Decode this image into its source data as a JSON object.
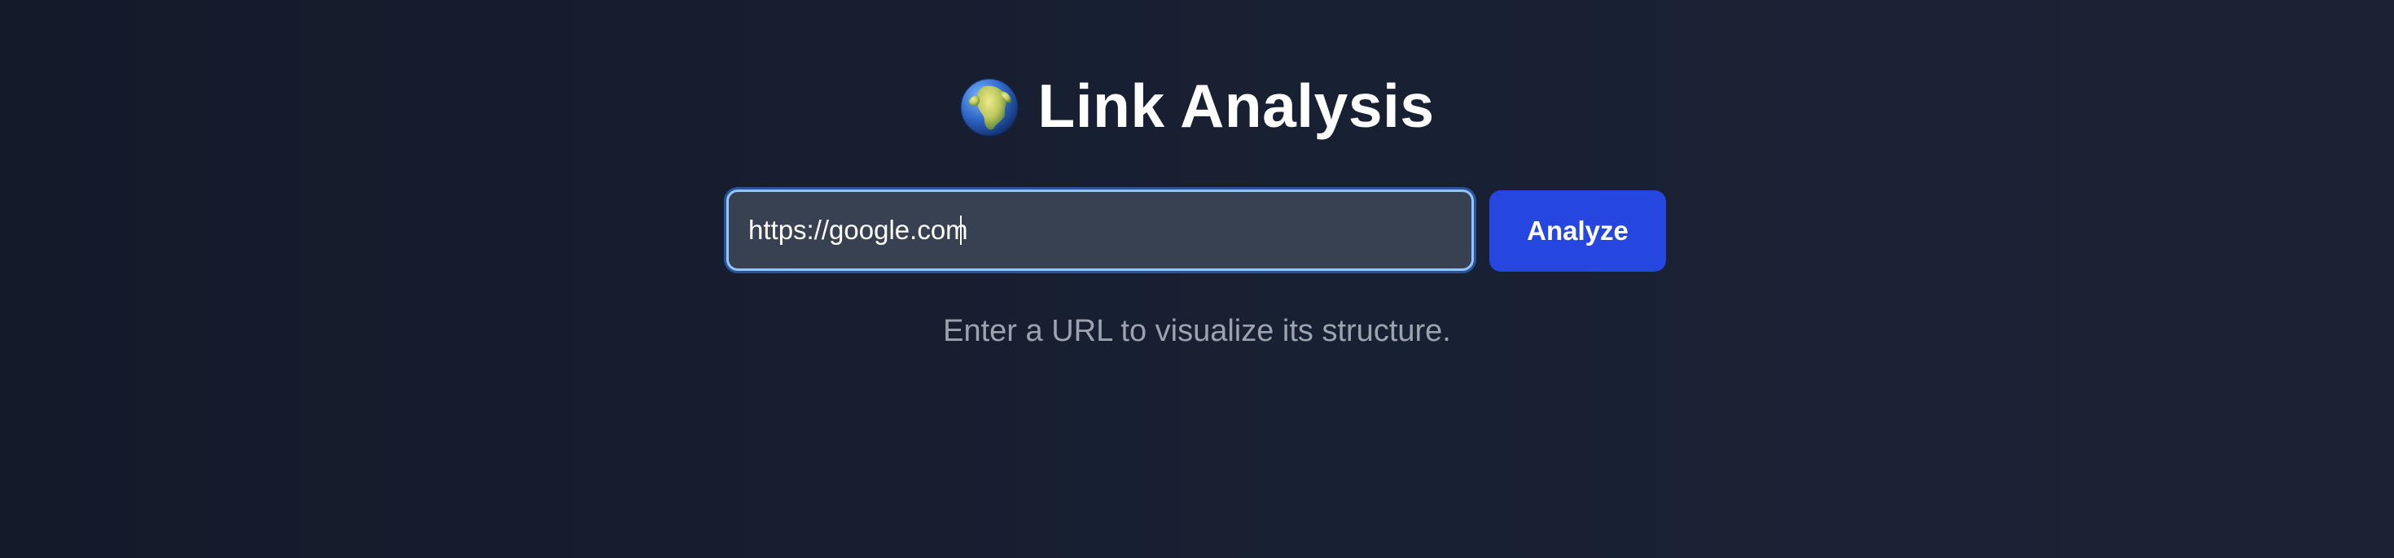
{
  "header": {
    "icon": "globe-icon",
    "title": "Link Analysis"
  },
  "form": {
    "url_value": "https://google.com",
    "analyze_label": "Analyze"
  },
  "hint": {
    "text": "Enter a URL to visualize its structure."
  },
  "colors": {
    "background": "#161d2d",
    "input_background": "#374151",
    "input_border": "#93c5fd",
    "button": "#2547e0",
    "hint_text": "#9ca3af"
  }
}
